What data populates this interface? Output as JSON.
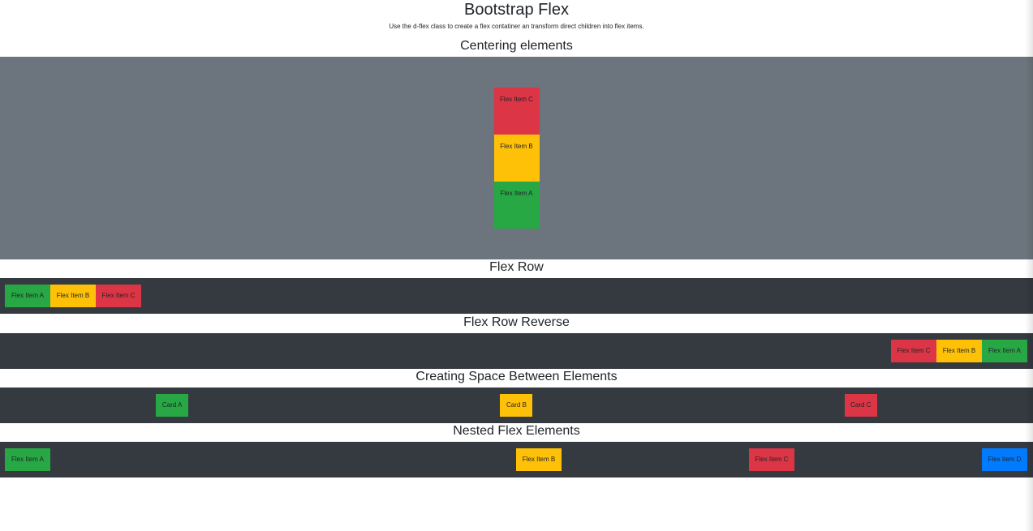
{
  "page": {
    "title": "Bootstrap Flex",
    "subtitle": "Use the d-flex class to create a flex contatiner an transform direct children into flex items."
  },
  "centering": {
    "heading": "Centering elements",
    "items": [
      "Flex Item C",
      "Flex Item B",
      "Flex Item A"
    ]
  },
  "flex_row": {
    "heading": "Flex Row",
    "items": [
      "Flex Item A",
      "Flex Item B",
      "Flex Item C"
    ]
  },
  "flex_row_reverse": {
    "heading": "Flex Row Reverse",
    "items": [
      "Flex Item A",
      "Flex Item B",
      "Flex Item C"
    ]
  },
  "space_between": {
    "heading": "Creating Space Between Elements",
    "cards": [
      "Card A",
      "Card B",
      "Card C"
    ]
  },
  "nested": {
    "heading": "Nested Flex Elements",
    "items": [
      "Flex Item A",
      "Flex Item B",
      "Flex Item C",
      "Flex Item D"
    ]
  },
  "colors": {
    "green": "#28a745",
    "yellow": "#ffc107",
    "red": "#dc3545",
    "blue": "#007bff",
    "gray_band": "#6c757d",
    "dark_band": "#343a40"
  }
}
